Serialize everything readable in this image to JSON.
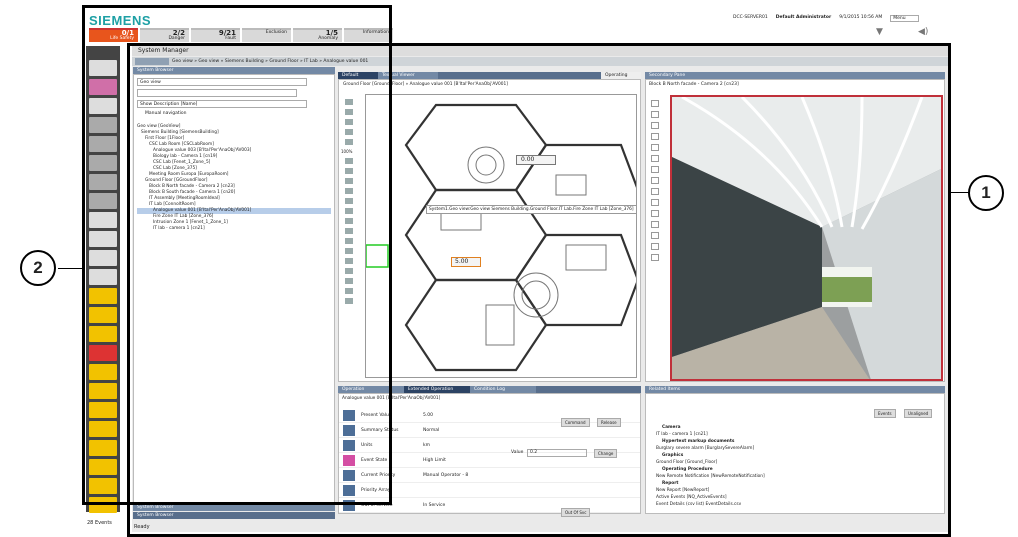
{
  "brand": "SIEMENS",
  "summary": [
    {
      "count": "0/1",
      "label": "Life Safety"
    },
    {
      "count": "2/2",
      "label": "Danger"
    },
    {
      "count": "9/21",
      "label": "Fault"
    },
    {
      "count": "",
      "label": "Exclusion"
    },
    {
      "count": "1/5",
      "label": "Anomaly"
    },
    {
      "count": "",
      "label": "Information"
    }
  ],
  "top": {
    "server": "DCC-SERVER01",
    "user": "Default Administrator",
    "datetime": "9/1/2015  10:56 AM",
    "menu": "Menu"
  },
  "title": "System Manager",
  "breadcrumb": "Geo view  »  Geo view  »  Siemens Building  »  Ground Floor  »  IT Lab  »  Analogue value 001",
  "browser": {
    "header": "System Browser",
    "view": "Geo view",
    "desc": "Show Description [Name]",
    "manual": "Manual navigation",
    "tree": [
      "Geo view [GeoView]",
      "Siemens Building [SiemensBuilding]",
      "First Floor [1Floor]",
      "CSC Lab Room [CSCLabRoom]",
      "Analogue value 003 [B'Ital'Per'AnaObj'AV003]",
      "Biology lab - Camera 1 [cn19]",
      "CSC Lab [Fenet_1_Zone_5]",
      "CSC Lab [Zone_375]",
      "Meeting  Room Europa [EuropaRoom]",
      "Ground Floor [GGroundFloor]",
      "Block B North facade - Camera 2 [cn23]",
      "Block B South facade - Camera 1 [cn20]",
      "IT Assembly [MeetingRoomIdeal]",
      "IT Lab [ConnoltRoom]",
      "Analogue value 001 [B'Ital'Per'AnaObj'AV001]",
      "Fire Zone IT Lab [Zone_376]",
      "Intrusion Zone 1 [Fenet_1_Zone_1]",
      "IT lab - camera 1 [cn21]"
    ],
    "footer1": "System Browser",
    "footer2": "System Browser"
  },
  "tabs": {
    "default": "Default",
    "textual": "Textual Viewer",
    "operating": "Operating"
  },
  "graphics": {
    "path": "Ground Floor [Ground_Floor]   »   Analogue value 001 [B'Ital'Per'AnaObj'AV001]",
    "value1": "0.00",
    "value2": "5.00",
    "tooltip": "System1.Geo view:Geo view Siemens Building.Ground Floor.IT Lab.Fire Zone IT Lab [Zone_376]",
    "zoom": "100%"
  },
  "secondary": {
    "header": "Secondary Pane",
    "camera": "Block B North facade - Camera 2 [cn23]"
  },
  "ops": {
    "tabs": [
      "Operation",
      "Extended Operation",
      "Condition Log"
    ],
    "object": "Analogue value 001 [B'Ital'Per'AnaObj'AV001]",
    "rows": [
      {
        "k": "Present Value",
        "v": "5.00"
      },
      {
        "k": "Summary Status",
        "v": "Normal"
      },
      {
        "k": "Units",
        "v": "km"
      },
      {
        "k": "Event State",
        "v": "High Limit"
      },
      {
        "k": "Current Priority",
        "v": "Manual Operator - 8"
      },
      {
        "k": "Priority Array",
        "v": ""
      },
      {
        "k": "Out of service",
        "v": "In Service"
      }
    ],
    "value_label": "Value",
    "value_field": "0.2",
    "change": "Change",
    "command": "Command",
    "release": "Release",
    "outofservice": "Out Of Svc"
  },
  "related": {
    "header": "Related Items",
    "b1": "Events",
    "b2": "Unaligned",
    "items": [
      "Camera",
      "IT lab - camera 1 [cn21]",
      "Hypertext markup documents",
      "Burglary severe alarm [BurglarySevereAlarm]",
      "Graphics",
      "Ground Floor [Ground_Floor]",
      "Operating Procedure",
      "New Remote Notification [NewRemoteNotification]",
      "Report",
      "New Report [NewReport]",
      "Active Events [NQ_ActiveEvents]",
      "Event Details (csv list) EventDetails.csv"
    ]
  },
  "status": {
    "ready": "Ready",
    "events": "28 Events"
  },
  "callouts": {
    "c1": "1",
    "c2": "2"
  }
}
